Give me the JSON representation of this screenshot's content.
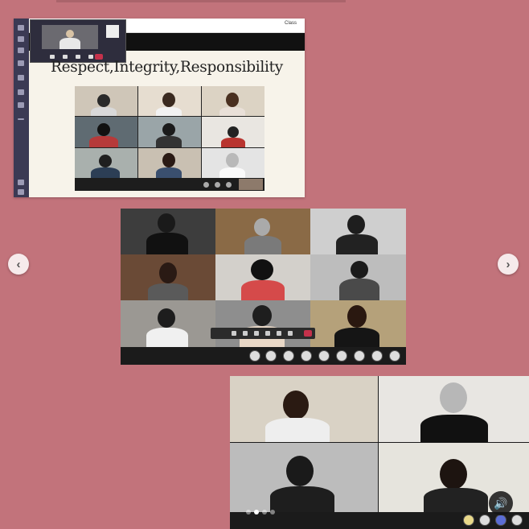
{
  "slide": {
    "title": "Respect,Integrity,Responsibility",
    "topbar_label": "Class"
  },
  "carousel": {
    "prev_icon": "chevron-left-icon",
    "next_icon": "chevron-right-icon",
    "dots": 4,
    "active_dot": 1,
    "sound_icon": "speaker-icon",
    "prev_glyph": "‹",
    "next_glyph": "›",
    "sound_glyph": "🔊"
  },
  "colors": {
    "background": "#c2737b",
    "teams_rail": "#3b3a54",
    "end_call": "#c4314b"
  }
}
